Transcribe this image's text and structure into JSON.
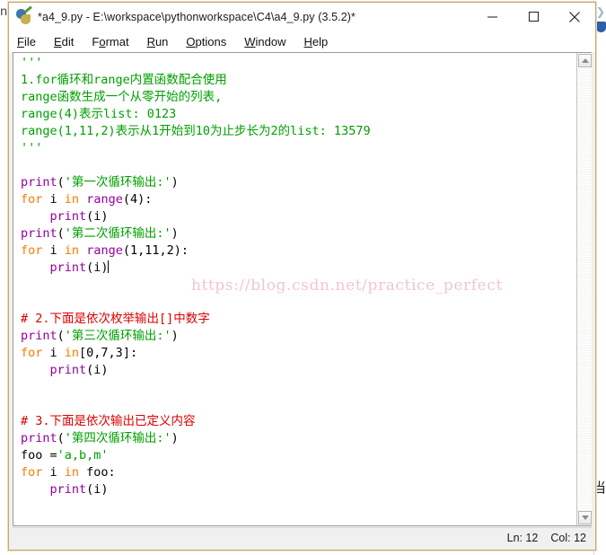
{
  "window": {
    "title": "*a4_9.py - E:\\workspace\\pythonworkspace\\C4\\a4_9.py (3.5.2)*",
    "icon": "python-idle-icon",
    "controls": {
      "minimize": "—",
      "maximize": "□",
      "close": "✕"
    }
  },
  "menubar": {
    "items": [
      {
        "label": "File",
        "accel": "F"
      },
      {
        "label": "Edit",
        "accel": "E"
      },
      {
        "label": "Format",
        "accel": "o"
      },
      {
        "label": "Run",
        "accel": "R"
      },
      {
        "label": "Options",
        "accel": "O"
      },
      {
        "label": "Window",
        "accel": "W"
      },
      {
        "label": "Help",
        "accel": "H"
      }
    ]
  },
  "editor": {
    "watermark": "https://blog.csdn.net/practice_perfect",
    "lines": [
      {
        "n": 1,
        "text": "'''",
        "tokens": [
          {
            "t": "'''",
            "c": "str"
          }
        ]
      },
      {
        "n": 2,
        "text": "1.for循环和range内置函数配合使用",
        "tokens": [
          {
            "t": "1.for循环和range内置函数配合使用",
            "c": "str"
          }
        ]
      },
      {
        "n": 3,
        "text": "range函数生成一个从零开始的列表,",
        "tokens": [
          {
            "t": "range函数生成一个从零开始的列表,",
            "c": "str"
          }
        ]
      },
      {
        "n": 4,
        "text": "range(4)表示list: 0123",
        "tokens": [
          {
            "t": "range(4)表示list: 0123",
            "c": "str"
          }
        ]
      },
      {
        "n": 5,
        "text": "range(1,11,2)表示从1开始到10为止步长为2的list: 13579",
        "tokens": [
          {
            "t": "range(1,11,2)表示从1开始到10为止步长为2的list: 13579",
            "c": "str"
          }
        ]
      },
      {
        "n": 6,
        "text": "'''",
        "tokens": [
          {
            "t": "'''",
            "c": "str"
          }
        ]
      },
      {
        "n": 7,
        "text": "",
        "tokens": []
      },
      {
        "n": 8,
        "text": "print('第一次循环输出:')",
        "tokens": [
          {
            "t": "print",
            "c": "bi"
          },
          {
            "t": "(",
            "c": "def"
          },
          {
            "t": "'第一次循环输出:'",
            "c": "str"
          },
          {
            "t": ")",
            "c": "def"
          }
        ]
      },
      {
        "n": 9,
        "text": "for i in range(4):",
        "tokens": [
          {
            "t": "for",
            "c": "kw"
          },
          {
            "t": " i ",
            "c": "def"
          },
          {
            "t": "in",
            "c": "kw"
          },
          {
            "t": " ",
            "c": "def"
          },
          {
            "t": "range",
            "c": "bi"
          },
          {
            "t": "(4):",
            "c": "def"
          }
        ]
      },
      {
        "n": 10,
        "text": "    print(i)",
        "tokens": [
          {
            "t": "    ",
            "c": "def"
          },
          {
            "t": "print",
            "c": "bi"
          },
          {
            "t": "(i)",
            "c": "def"
          }
        ]
      },
      {
        "n": 11,
        "text": "print('第二次循环输出:')",
        "tokens": [
          {
            "t": "print",
            "c": "bi"
          },
          {
            "t": "(",
            "c": "def"
          },
          {
            "t": "'第二次循环输出:'",
            "c": "str"
          },
          {
            "t": ")",
            "c": "def"
          }
        ]
      },
      {
        "n": 12,
        "text": "for i in range(1,11,2):",
        "tokens": [
          {
            "t": "for",
            "c": "kw"
          },
          {
            "t": " i ",
            "c": "def"
          },
          {
            "t": "in",
            "c": "kw"
          },
          {
            "t": " ",
            "c": "def"
          },
          {
            "t": "range",
            "c": "bi"
          },
          {
            "t": "(1,11,2):",
            "c": "def"
          }
        ]
      },
      {
        "n": 13,
        "text": "    print(i)",
        "tokens": [
          {
            "t": "    ",
            "c": "def"
          },
          {
            "t": "print",
            "c": "bi"
          },
          {
            "t": "(i)",
            "c": "def"
          }
        ],
        "caret": true
      },
      {
        "n": 14,
        "text": "",
        "tokens": []
      },
      {
        "n": 15,
        "text": "",
        "tokens": []
      },
      {
        "n": 16,
        "text": "# 2.下面是依次枚举输出[]中数字",
        "tokens": [
          {
            "t": "# 2.下面是依次枚举输出[]中数字",
            "c": "com"
          }
        ]
      },
      {
        "n": 17,
        "text": "print('第三次循环输出:')",
        "tokens": [
          {
            "t": "print",
            "c": "bi"
          },
          {
            "t": "(",
            "c": "def"
          },
          {
            "t": "'第三次循环输出:'",
            "c": "str"
          },
          {
            "t": ")",
            "c": "def"
          }
        ]
      },
      {
        "n": 18,
        "text": "for i in[0,7,3]:",
        "tokens": [
          {
            "t": "for",
            "c": "kw"
          },
          {
            "t": " i ",
            "c": "def"
          },
          {
            "t": "in",
            "c": "kw"
          },
          {
            "t": "[0,7,3]:",
            "c": "def"
          }
        ]
      },
      {
        "n": 19,
        "text": "    print(i)",
        "tokens": [
          {
            "t": "    ",
            "c": "def"
          },
          {
            "t": "print",
            "c": "bi"
          },
          {
            "t": "(i)",
            "c": "def"
          }
        ]
      },
      {
        "n": 20,
        "text": "",
        "tokens": []
      },
      {
        "n": 21,
        "text": "",
        "tokens": []
      },
      {
        "n": 22,
        "text": "# 3.下面是依次输出已定义内容",
        "tokens": [
          {
            "t": "# 3.下面是依次输出已定义内容",
            "c": "com"
          }
        ]
      },
      {
        "n": 23,
        "text": "print('第四次循环输出:')",
        "tokens": [
          {
            "t": "print",
            "c": "bi"
          },
          {
            "t": "(",
            "c": "def"
          },
          {
            "t": "'第四次循环输出:'",
            "c": "str"
          },
          {
            "t": ")",
            "c": "def"
          }
        ]
      },
      {
        "n": 24,
        "text": "foo ='a,b,m'",
        "tokens": [
          {
            "t": "foo =",
            "c": "def"
          },
          {
            "t": "'a,b,m'",
            "c": "str"
          }
        ]
      },
      {
        "n": 25,
        "text": "for i in foo:",
        "tokens": [
          {
            "t": "for",
            "c": "kw"
          },
          {
            "t": " i ",
            "c": "def"
          },
          {
            "t": "in",
            "c": "kw"
          },
          {
            "t": " foo:",
            "c": "def"
          }
        ]
      },
      {
        "n": 26,
        "text": "    print(i)",
        "tokens": [
          {
            "t": "    ",
            "c": "def"
          },
          {
            "t": "print",
            "c": "bi"
          },
          {
            "t": "(i)",
            "c": "def"
          }
        ]
      }
    ]
  },
  "scrollbar": {
    "up_arrow": "scroll-up-arrow",
    "down_arrow": "scroll-down-arrow"
  },
  "statusbar": {
    "line": "Ln: 12",
    "col": "Col: 12"
  },
  "desktop": {
    "left_glyph": "n",
    "right_glyph": "当"
  },
  "colors": {
    "string": "#00a000",
    "comment": "#dd0000",
    "keyword": "#ff7700",
    "builtin": "#9400a0",
    "default": "#000000",
    "window_border": "#c8a96a",
    "watermark": "#dc828c"
  }
}
